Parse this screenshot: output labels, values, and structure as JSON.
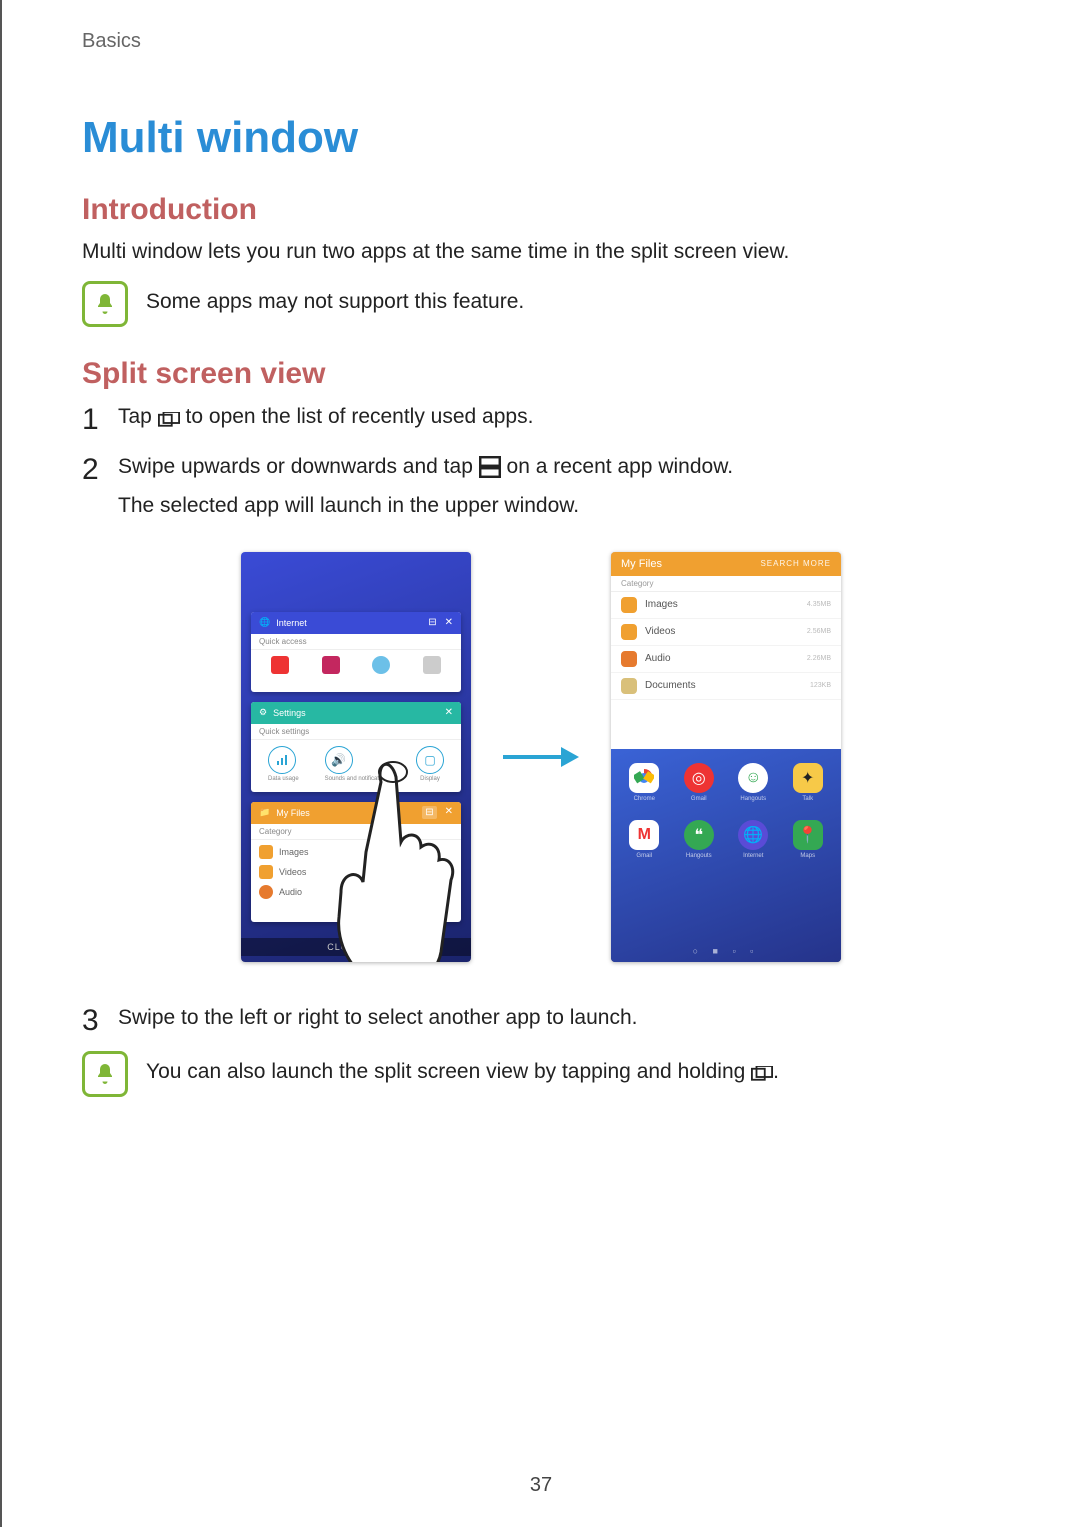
{
  "breadcrumb": "Basics",
  "title": "Multi window",
  "section_intro": "Introduction",
  "intro_text": "Multi window lets you run two apps at the same time in the split screen view.",
  "note1": "Some apps may not support this feature.",
  "section_split": "Split screen view",
  "step1_a": "Tap ",
  "step1_b": " to open the list of recently used apps.",
  "step2_a": "Swipe upwards or downwards and tap ",
  "step2_b": " on a recent app window.",
  "step2_c": "The selected app will launch in the upper window.",
  "step3": "Swipe to the left or right to select another app to launch.",
  "note2_a": "You can also launch the split screen view by tapping and holding ",
  "note2_b": ".",
  "left_phone": {
    "card1": {
      "title": "Internet",
      "sub": "Quick access"
    },
    "card2": {
      "title": "Settings",
      "sub": "Quick settings",
      "icons": [
        "Data usage",
        "Sounds and notifications",
        "Display"
      ]
    },
    "card3": {
      "title": "My Files",
      "sub": "Category",
      "rows": [
        "Images",
        "Videos",
        "Audio"
      ]
    },
    "close_all": "CLOSE ALL"
  },
  "right_phone": {
    "header": "My Files",
    "header_actions": "SEARCH   MORE",
    "category_label": "Category",
    "items": [
      {
        "name": "Images",
        "meta": "4.35MB",
        "color": "#f0a030"
      },
      {
        "name": "Videos",
        "meta": "2.56MB",
        "color": "#f0a030"
      },
      {
        "name": "Audio",
        "meta": "2.26MB",
        "color": "#e67a2e"
      },
      {
        "name": "Documents",
        "meta": "123KB",
        "color": "#d9c07a"
      }
    ],
    "apps_row1": [
      "Chrome",
      "Gmail",
      "Hangouts",
      "Talk"
    ],
    "apps_row2": [
      "Gmail",
      "Hangouts",
      "Internet",
      "Maps"
    ]
  },
  "page_number": "37"
}
